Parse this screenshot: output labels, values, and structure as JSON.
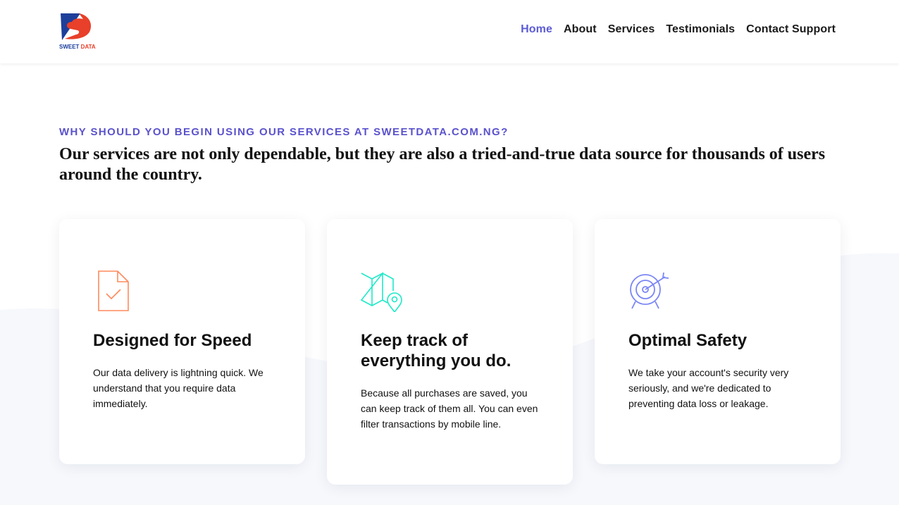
{
  "logo": {
    "text": "SWEET DATA"
  },
  "nav": {
    "items": [
      {
        "label": "Home"
      },
      {
        "label": "About"
      },
      {
        "label": "Services"
      },
      {
        "label": "Testimonials"
      },
      {
        "label": "Contact Support"
      }
    ]
  },
  "section": {
    "eyebrow": "WHY SHOULD YOU BEGIN USING OUR SERVICES AT SWEETDATA.COM.NG?",
    "headline": "Our services are not only dependable, but they are also a tried-and-true data source for thousands of users around the country."
  },
  "cards": [
    {
      "icon": "document-check-icon",
      "title": "Designed for Speed",
      "text": "Our data delivery is lightning quick. We understand that you require data immediately.",
      "color": "#ff8a5c"
    },
    {
      "icon": "map-pin-icon",
      "title": "Keep track of everything you do.",
      "text": "Because all purchases are saved, you can keep track of them all. You can even filter transactions by mobile line.",
      "color": "#1de9c8"
    },
    {
      "icon": "target-icon",
      "title": "Optimal Safety",
      "text": "We take your account's security very seriously, and we're dedicated to preventing data loss or leakage.",
      "color": "#7b86f5"
    }
  ]
}
